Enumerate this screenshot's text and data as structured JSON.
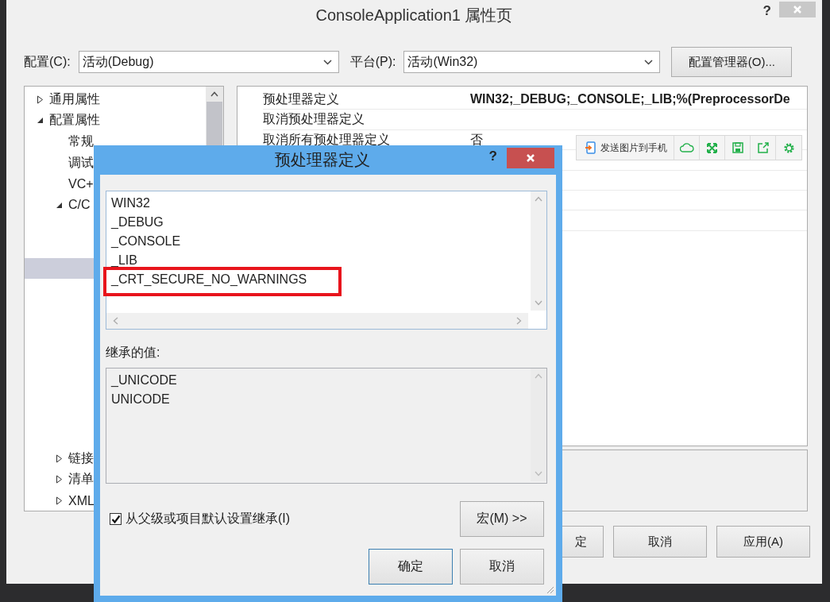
{
  "window": {
    "title": "ConsoleApplication1 属性页",
    "help": "?"
  },
  "config": {
    "label": "配置(C):",
    "value": "活动(Debug)"
  },
  "platform": {
    "label": "平台(P):",
    "value": "活动(Win32)"
  },
  "config_manager_button": "配置管理器(O)...",
  "tree": [
    {
      "label": "通用属性",
      "expanded": false,
      "selected": false
    },
    {
      "label": "配置属性",
      "expanded": true,
      "selected": false,
      "children": [
        {
          "label": "常规",
          "selected": false
        },
        {
          "label": "调试",
          "selected": false
        },
        {
          "label": "VC+",
          "selected": false
        },
        {
          "label": "C/C",
          "expanded": true,
          "selected": false,
          "children": [
            {
              "selected": false
            },
            {
              "selected": false
            },
            {
              "selected": true
            },
            {
              "selected": false
            },
            {
              "selected": false
            },
            {
              "selected": false
            },
            {
              "selected": false
            },
            {
              "selected": false
            },
            {
              "selected": false
            },
            {
              "selected": false
            },
            {
              "selected": false
            }
          ]
        },
        {
          "label": "链接",
          "expanded": false,
          "selected": false
        },
        {
          "label": "清单",
          "expanded": false,
          "selected": false
        },
        {
          "label": "XML",
          "expanded": false,
          "selected": false
        }
      ]
    }
  ],
  "properties": [
    {
      "name": "预处理器定义",
      "value": "WIN32;_DEBUG;_CONSOLE;_LIB;%(PreprocessorDe",
      "bold": true
    },
    {
      "name": "取消预处理器定义"
    },
    {
      "name": "取消所有预处理器定义",
      "value": "否",
      "bold": false
    }
  ],
  "overlay_toolbar": {
    "send_button": "发送图片到手机"
  },
  "buttons": [
    "定",
    "取消",
    "应用(A)"
  ],
  "dialog": {
    "title": "预处理器定义",
    "help": "?",
    "definitions": [
      "WIN32",
      "_DEBUG",
      "_CONSOLE",
      "_LIB",
      "_CRT_SECURE_NO_WARNINGS"
    ],
    "inherited_label": "继承的值:",
    "inherited": [
      "_UNICODE",
      "UNICODE"
    ],
    "inherit": {
      "label": "从父级或项目默认设置继承(I)",
      "checked": true
    },
    "macro_button": "宏(M) >>",
    "ok_button": "确定",
    "cancel_button": "取消"
  }
}
